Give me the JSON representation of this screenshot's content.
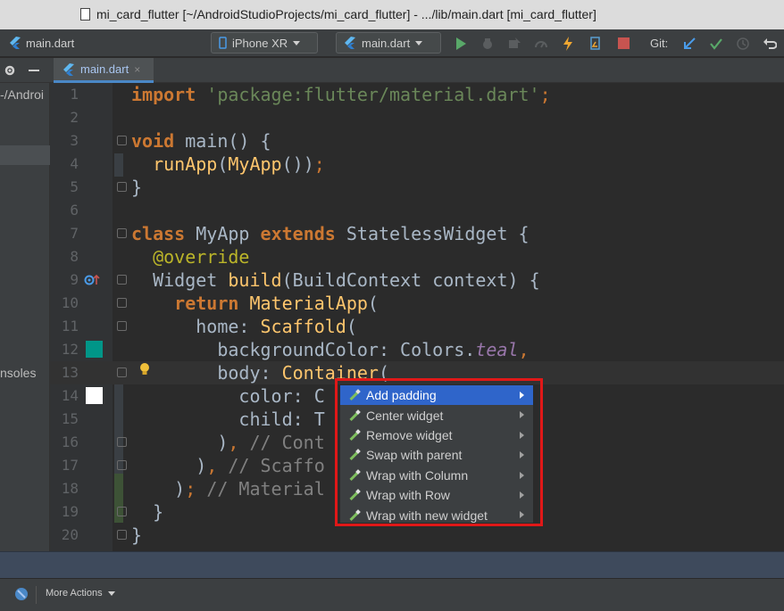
{
  "window": {
    "title": "mi_card_flutter [~/AndroidStudioProjects/mi_card_flutter] - .../lib/main.dart [mi_card_flutter]"
  },
  "toolbar": {
    "breadcrumb_file": "main.dart",
    "device": "iPhone XR",
    "run_config": "main.dart",
    "git_label": "Git:"
  },
  "tabs": [
    {
      "label": "main.dart",
      "active": true
    }
  ],
  "left_panel": {
    "path_fragment": "-/Androi",
    "consoles_fragment": "nsoles"
  },
  "editor": {
    "line_numbers": [
      "1",
      "2",
      "3",
      "4",
      "5",
      "6",
      "7",
      "8",
      "9",
      "10",
      "11",
      "12",
      "13",
      "14",
      "15",
      "16",
      "17",
      "18",
      "19",
      "20"
    ],
    "lines": [
      "import 'package:flutter/material.dart';",
      "",
      "void main() {",
      "  runApp(MyApp());",
      "}",
      "",
      "class MyApp extends StatelessWidget {",
      "  @override",
      "  Widget build(BuildContext context) {",
      "    return MaterialApp(",
      "      home: Scaffold(",
      "        backgroundColor: Colors.teal,",
      "        body: Container(",
      "          color: C",
      "          child: T",
      "        ), // Cont",
      "      ), // Scaffo",
      "    ); // Material",
      "  }",
      "}"
    ],
    "gutter_colors": {
      "line12": "#009688",
      "line14": "#ffffff"
    }
  },
  "context_menu": {
    "items": [
      {
        "label": "Add padding",
        "selected": true
      },
      {
        "label": "Center widget",
        "selected": false
      },
      {
        "label": "Remove widget",
        "selected": false
      },
      {
        "label": "Swap with parent",
        "selected": false
      },
      {
        "label": "Wrap with Column",
        "selected": false
      },
      {
        "label": "Wrap with Row",
        "selected": false
      },
      {
        "label": "Wrap with new widget",
        "selected": false
      }
    ],
    "highlight_color": "#e01818"
  },
  "statusbar": {
    "more_actions": "More Actions"
  },
  "colors": {
    "accent": "#2f65ca",
    "run_green": "#59a869",
    "stop_red": "#c75450"
  }
}
